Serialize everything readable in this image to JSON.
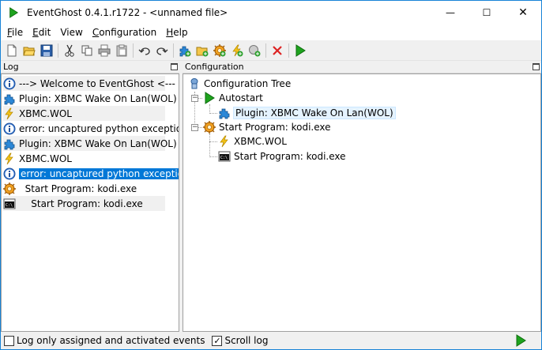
{
  "window": {
    "title": "EventGhost 0.4.1.r1722 - <unnamed file>",
    "minimize_glyph": "—",
    "maximize_glyph": "☐",
    "close_glyph": "✕"
  },
  "menu": [
    {
      "label": "File",
      "u": "F",
      "rest": "ile"
    },
    {
      "label": "Edit",
      "u": "E",
      "rest": "dit"
    },
    {
      "label": "View",
      "u": "",
      "rest": "View"
    },
    {
      "label": "Configuration",
      "u": "C",
      "rest": "onfiguration"
    },
    {
      "label": "Help",
      "u": "H",
      "rest": "elp"
    }
  ],
  "toolbar": {
    "icons": [
      "new-file-icon",
      "open-folder-icon",
      "save-icon",
      "cut-icon",
      "copy-icon",
      "print-icon",
      "paste-icon",
      "undo-icon",
      "redo-icon",
      "add-plugin-icon",
      "add-folder-icon",
      "add-macro-icon",
      "add-event-icon",
      "add-action-icon",
      "delete-icon",
      "execute-icon"
    ]
  },
  "log_panel": {
    "title": "Log",
    "rows": [
      {
        "icon": "info-icon",
        "text": "---> Welcome to EventGhost <---",
        "alt": true,
        "selected": false
      },
      {
        "icon": "plugin-icon",
        "text": "Plugin: XBMC Wake On Lan(WOL)",
        "alt": false,
        "selected": false
      },
      {
        "icon": "event-icon",
        "text": "XBMC.WOL",
        "alt": true,
        "selected": false
      },
      {
        "icon": "info-icon",
        "text": "error: uncaptured python exception",
        "alt": false,
        "selected": false
      },
      {
        "icon": "plugin-icon",
        "text": "Plugin: XBMC Wake On Lan(WOL)",
        "alt": true,
        "selected": false
      },
      {
        "icon": "event-icon",
        "text": "XBMC.WOL",
        "alt": false,
        "selected": false
      },
      {
        "icon": "info-icon",
        "text": "error: uncaptured python exception",
        "alt": false,
        "selected": true
      },
      {
        "icon": "macro-icon",
        "text": "  Start Program: kodi.exe",
        "alt": false,
        "selected": false
      },
      {
        "icon": "console-icon",
        "text": "    Start Program: kodi.exe",
        "alt": true,
        "selected": false
      }
    ]
  },
  "config_panel": {
    "title": "Configuration",
    "tree": [
      {
        "icon": "config-tree-icon",
        "text": "Configuration Tree"
      },
      {
        "icon": "autostart-icon",
        "text": "Autostart"
      },
      {
        "icon": "plugin-icon",
        "text": "Plugin: XBMC Wake On Lan(WOL)"
      },
      {
        "icon": "macro-icon",
        "text": "Start Program: kodi.exe"
      },
      {
        "icon": "event-icon",
        "text": "XBMC.WOL"
      },
      {
        "icon": "console-icon",
        "text": "Start Program: kodi.exe"
      }
    ]
  },
  "statusbar": {
    "log_only_label": "Log only assigned and activated events",
    "log_only_checked": false,
    "scroll_log_label": "Scroll log",
    "scroll_log_checked": true,
    "check_mark": "✓"
  },
  "colors": {
    "selection": "#0078d7",
    "accent_green": "#1ea31e",
    "window_border": "#1883d7"
  }
}
